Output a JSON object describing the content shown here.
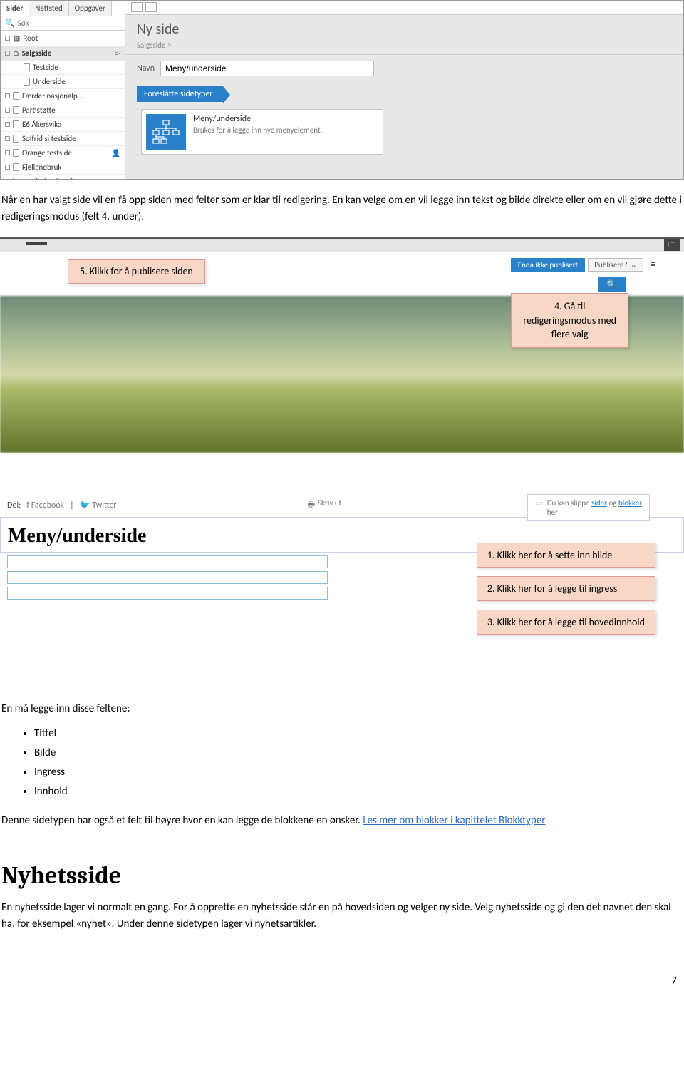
{
  "shot1": {
    "tabs": [
      "Sider",
      "Nettsted",
      "Oppgaver"
    ],
    "search_placeholder": "Søk",
    "root_label": "Root",
    "selected_item": "Salgsside",
    "tree": [
      "Testside",
      "Underside",
      "Færder nasjonalp...",
      "Partistøtte",
      "E6 Åkersvika",
      "Solfrid si testside",
      "Orange testside",
      "Fjellandbruk",
      "Jomfruland nasjo..."
    ],
    "page_title": "Ny side",
    "breadcrumb": "Salgsside >",
    "name_label": "Navn",
    "name_value": "Meny/underside",
    "suggest_label": "Foreslåtte sidetyper",
    "type_title": "Meny/underside",
    "type_desc": "Brukes for å legge inn nye menyelement."
  },
  "para1": "Når en har valgt side vil en få opp siden med felter som er klar til redigering. En kan velge om en vil legge inn tekst og bilde direkte eller om en vil gjøre dette i redigeringsmodus (felt 4. under).",
  "shot2": {
    "not_published": "Enda ikke publisert",
    "publish_btn": "Publisere?",
    "call5": "5. Klikk for å publisere siden",
    "call4_l1": "4. Gå til",
    "call4_l2": "redigeringsmodus med",
    "call4_l3": "flere valg",
    "search_icon": "🔍"
  },
  "shot3": {
    "del_label": "Del:",
    "fb": "Facebook",
    "tw": "Twitter",
    "print": "Skriv ut",
    "drop_text1": "Du kan slippe",
    "drop_link1": "sider",
    "drop_text2": "og",
    "drop_link2": "blokker",
    "drop_text3": "her",
    "big_title": "Meny/underside",
    "call1": "1. Klikk her for å sette inn bilde",
    "call2": "2. Klikk her for å legge til ingress",
    "call3": "3. Klikk her for å legge til hovedinnhold"
  },
  "fields_intro": "En må legge inn disse feltene:",
  "fields": [
    "Tittel",
    "Bilde",
    "Ingress",
    "Innhold"
  ],
  "sidetype_text1": "Denne sidetypen har også et felt til høyre hvor en kan legge de blokkene en ønsker. ",
  "sidetype_link": "Les mer om blokker i kapittelet Blokktyper",
  "heading_nyhet": "Nyhetsside",
  "nyhet_text": "En nyhetsside lager vi normalt en gang. For å opprette en nyhetsside står en på hovedsiden og velger ny side. Velg nyhetsside og gi den det navnet den skal ha, for eksempel «nyhet».  Under denne sidetypen lager vi nyhetsartikler.",
  "page_number": "7"
}
